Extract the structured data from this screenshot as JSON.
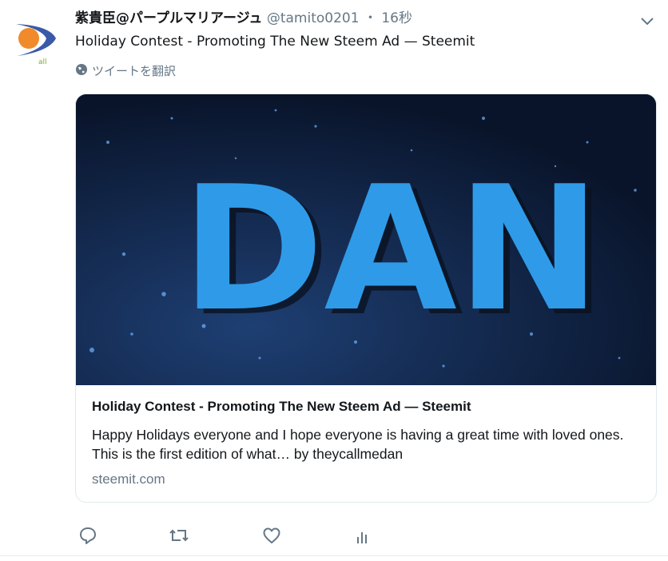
{
  "tweet": {
    "author_name": "紫貴臣@パープルマリアージュ",
    "handle": "@tamito0201",
    "separator": "・",
    "time": "16秒",
    "text": "Holiday Contest - Promoting The New Steem Ad — Steemit",
    "translate_label": "ツイートを翻訳"
  },
  "card": {
    "image_text": "DAN",
    "title": "Holiday Contest - Promoting The New Steem Ad — Steemit",
    "description": "Happy Holidays everyone and I hope everyone is having a great time with loved ones. This is the first edition of what… by theycallmedan",
    "domain": "steemit.com"
  },
  "avatar": {
    "logo_text": "all"
  },
  "actions": [
    "reply-icon",
    "retweet-icon",
    "like-icon",
    "analytics-icon"
  ],
  "colors": {
    "text": "#14171a",
    "secondary": "#657786",
    "border": "#e1e8ed",
    "card_image_bg": "#0c1a33",
    "dan_blue": "#2f9be8"
  }
}
